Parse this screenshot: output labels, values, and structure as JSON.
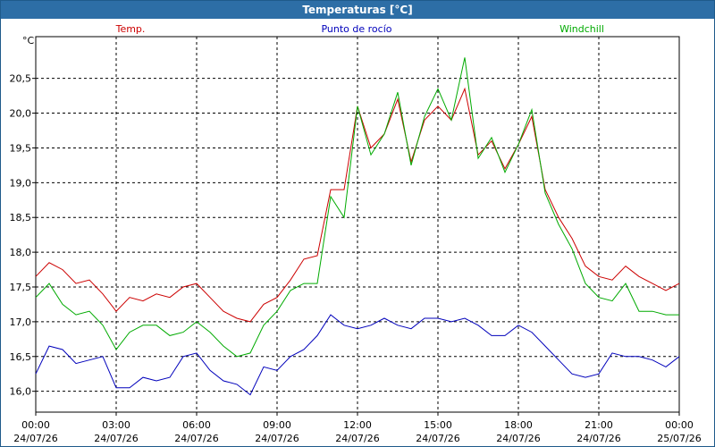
{
  "window": {
    "title": "Temperaturas [°C]"
  },
  "chart_data": {
    "type": "line",
    "title": "Temperaturas [°C]",
    "ylabel": "°C",
    "ylim": [
      15.7,
      21.1
    ],
    "yticks": [
      16.0,
      16.5,
      17.0,
      17.5,
      18.0,
      18.5,
      19.0,
      19.5,
      20.0,
      20.5
    ],
    "ytick_labels": [
      "16,0",
      "16,5",
      "17,0",
      "17,5",
      "18,0",
      "18,5",
      "19,0",
      "19,5",
      "20,0",
      "20,5"
    ],
    "x_hours": [
      0,
      0.5,
      1,
      1.5,
      2,
      2.5,
      3,
      3.5,
      4,
      4.5,
      5,
      5.5,
      6,
      6.5,
      7,
      7.5,
      8,
      8.5,
      9,
      9.5,
      10,
      10.5,
      11,
      11.5,
      12,
      12.5,
      13,
      13.5,
      14,
      14.5,
      15,
      15.5,
      16,
      16.5,
      17,
      17.5,
      18,
      18.5,
      19,
      19.5,
      20,
      20.5,
      21,
      21.5,
      22,
      22.5,
      23,
      23.5,
      24
    ],
    "xticks": [
      {
        "time": "00:00",
        "date": "24/07/26"
      },
      {
        "time": "03:00",
        "date": "24/07/26"
      },
      {
        "time": "06:00",
        "date": "24/07/26"
      },
      {
        "time": "09:00",
        "date": "24/07/26"
      },
      {
        "time": "12:00",
        "date": "24/07/26"
      },
      {
        "time": "15:00",
        "date": "24/07/26"
      },
      {
        "time": "18:00",
        "date": "24/07/26"
      },
      {
        "time": "21:00",
        "date": "24/07/26"
      },
      {
        "time": "00:00",
        "date": "25/07/26"
      }
    ],
    "grid": true,
    "legend_position": "top",
    "series": [
      {
        "name": "Temp.",
        "color": "#cc0000",
        "values": [
          17.65,
          17.85,
          17.75,
          17.55,
          17.6,
          17.4,
          17.15,
          17.35,
          17.3,
          17.4,
          17.35,
          17.5,
          17.55,
          17.35,
          17.15,
          17.05,
          17.0,
          17.25,
          17.35,
          17.6,
          17.9,
          17.95,
          18.9,
          18.9,
          20.1,
          19.5,
          19.7,
          20.2,
          19.3,
          19.9,
          20.1,
          19.9,
          20.35,
          19.4,
          19.6,
          19.2,
          19.55,
          19.95,
          18.9,
          18.5,
          18.2,
          17.8,
          17.65,
          17.6,
          17.8,
          17.65,
          17.55,
          17.45,
          17.55
        ]
      },
      {
        "name": "Punto de rocío",
        "color": "#0000bb",
        "values": [
          16.25,
          16.65,
          16.6,
          16.4,
          16.45,
          16.5,
          16.05,
          16.05,
          16.2,
          16.15,
          16.2,
          16.5,
          16.55,
          16.3,
          16.15,
          16.1,
          15.95,
          16.35,
          16.3,
          16.5,
          16.6,
          16.8,
          17.1,
          16.95,
          16.9,
          16.95,
          17.05,
          16.95,
          16.9,
          17.05,
          17.05,
          17.0,
          17.05,
          16.95,
          16.8,
          16.8,
          16.95,
          16.85,
          16.65,
          16.45,
          16.25,
          16.2,
          16.25,
          16.55,
          16.5,
          16.5,
          16.45,
          16.35,
          16.5
        ]
      },
      {
        "name": "Windchill",
        "color": "#00aa00",
        "values": [
          17.35,
          17.55,
          17.25,
          17.1,
          17.15,
          16.95,
          16.6,
          16.85,
          16.95,
          16.95,
          16.8,
          16.85,
          17.0,
          16.85,
          16.65,
          16.5,
          16.55,
          16.95,
          17.15,
          17.45,
          17.55,
          17.55,
          18.8,
          18.5,
          20.1,
          19.4,
          19.7,
          20.3,
          19.25,
          19.95,
          20.35,
          19.9,
          20.8,
          19.35,
          19.65,
          19.15,
          19.55,
          20.05,
          18.85,
          18.4,
          18.05,
          17.55,
          17.35,
          17.3,
          17.55,
          17.15,
          17.15,
          17.1,
          17.1
        ]
      }
    ]
  }
}
